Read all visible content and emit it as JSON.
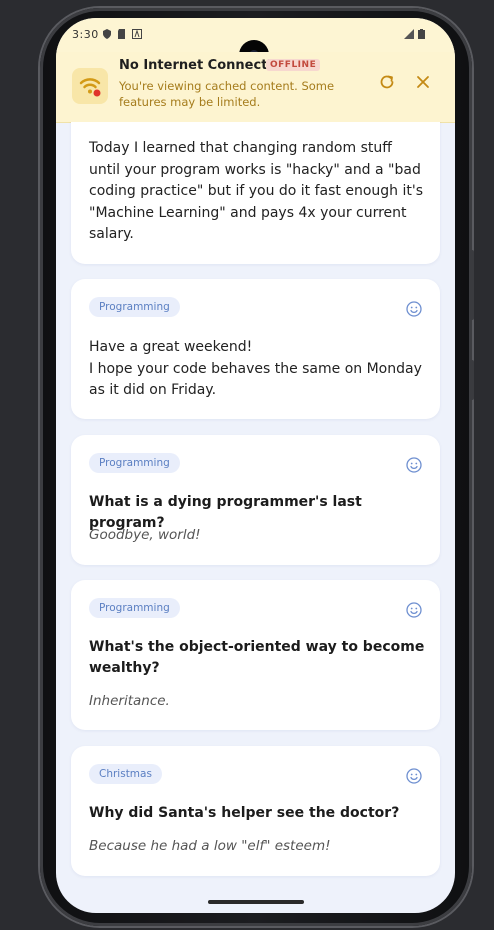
{
  "status_bar": {
    "time": "3:30"
  },
  "banner": {
    "title": "No Internet Connection",
    "badge": "OFFLINE",
    "message": "You're viewing cached content. Some features may be limited."
  },
  "cards": [
    {
      "text": "Today I learned that changing random stuff until your program works is \"hacky\" and a \"bad coding practice\" but if you do it fast enough it's \"Machine Learning\" and pays 4x your current salary."
    },
    {
      "tag": "Programming",
      "text": "Have a great weekend!\nI hope your code behaves the same on Monday as it did on Friday."
    },
    {
      "tag": "Programming",
      "question": "What is a dying programmer's last program?",
      "answer": "Goodbye, world!"
    },
    {
      "tag": "Programming",
      "question": "What's the object-oriented way to become wealthy?",
      "answer": "Inheritance."
    },
    {
      "tag": "Christmas",
      "question": "Why did Santa's helper see the doctor?",
      "answer": "Because he had a low \"elf\" esteem!"
    }
  ],
  "colors": {
    "banner_bg": "#fdf4d0",
    "badge_text": "#c24a3d",
    "tag_text": "#5b7fc2",
    "screen_bg": "#eef2fb"
  }
}
